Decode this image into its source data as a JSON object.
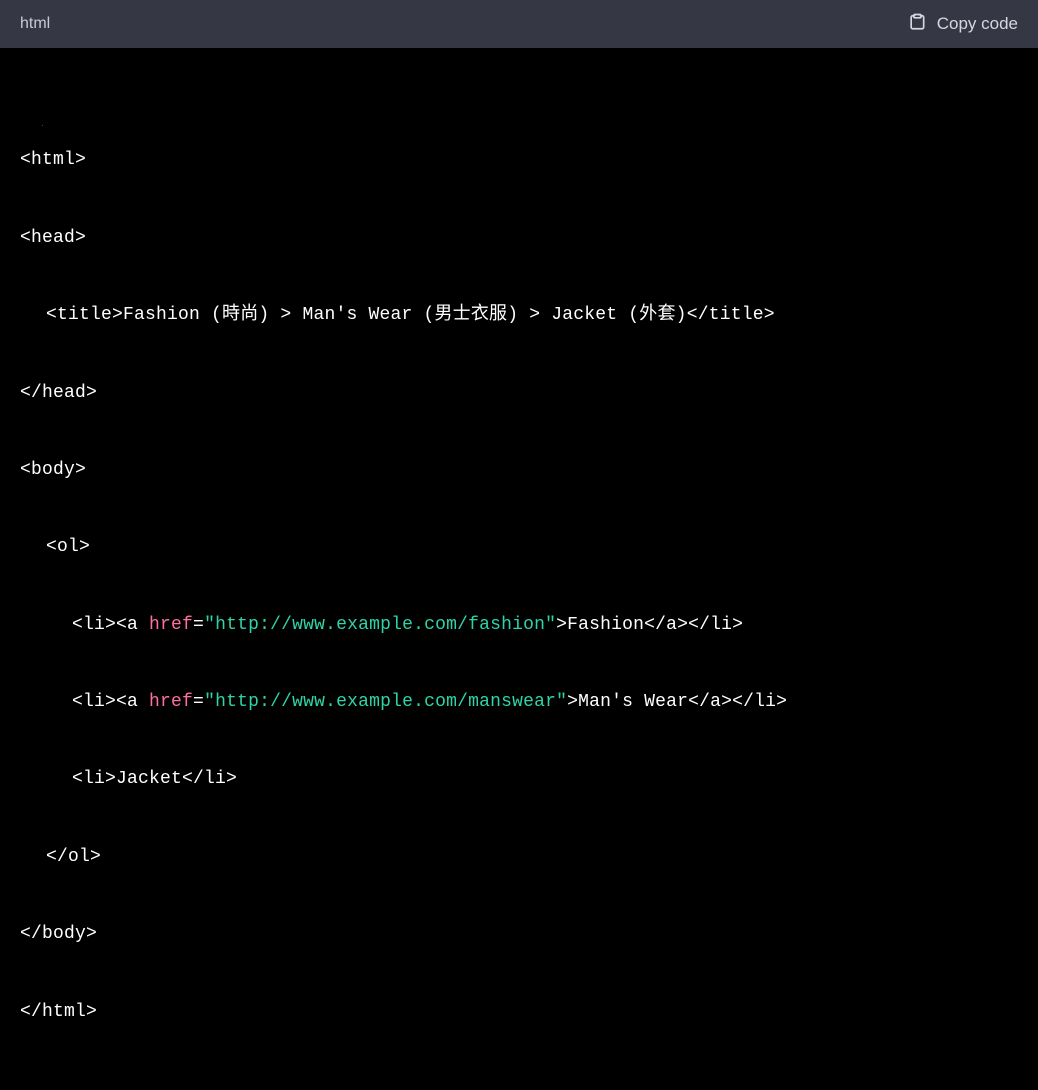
{
  "header": {
    "language": "html",
    "copy_label": "Copy code"
  },
  "code": {
    "l1": "<html>",
    "l2": "<head>",
    "l3a": "<title>",
    "l3b": "Fashion (時尚) > Man's Wear (男士衣服) > Jacket (外套)",
    "l3c": "</title>",
    "l4": "</head>",
    "l5": "<body>",
    "l6": "<ol>",
    "l7a": "<li><a",
    "attr_href": "href",
    "eq": "=",
    "l7url": "\"http://www.example.com/fashion\"",
    "l7b": ">",
    "l7txt": "Fashion",
    "l7c": "</a></li>",
    "l8url": "\"http://www.example.com/manswear\"",
    "l8txt": "Man's Wear",
    "l9a": "<li>",
    "l9txt": "Jacket",
    "l9b": "</li>",
    "l10": "</ol>",
    "l11": "</body>",
    "l12": "</html>"
  }
}
